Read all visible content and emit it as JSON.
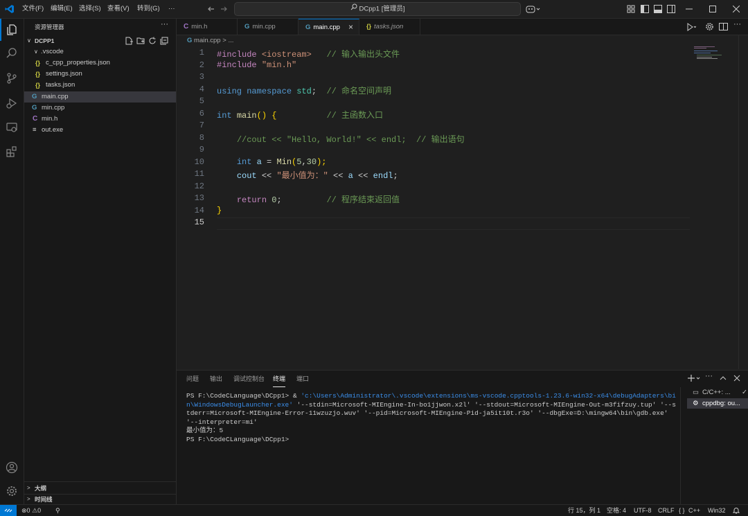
{
  "titlebar": {
    "menus": [
      "文件(F)",
      "编辑(E)",
      "选择(S)",
      "查看(V)",
      "转到(G)",
      "···"
    ],
    "command_center": "DCpp1 [管理员]",
    "accent": "#0078d4"
  },
  "sidebar": {
    "title": "资源管理器",
    "root": "DCPP1",
    "items": [
      {
        "label": ".vscode",
        "icon": "chevron-down-icon",
        "depth": 1
      },
      {
        "label": "c_cpp_properties.json",
        "icon": "json-icon",
        "depth": 2
      },
      {
        "label": "settings.json",
        "icon": "json-icon",
        "depth": 2
      },
      {
        "label": "tasks.json",
        "icon": "json-icon",
        "depth": 2
      },
      {
        "label": "main.cpp",
        "icon": "cpp-file-icon",
        "depth": 1,
        "selected": true
      },
      {
        "label": "min.cpp",
        "icon": "cpp-file-icon",
        "depth": 1
      },
      {
        "label": "min.h",
        "icon": "c-header-icon",
        "depth": 1
      },
      {
        "label": "out.exe",
        "icon": "binary-file-icon",
        "depth": 1
      }
    ],
    "outline": "大纲",
    "timeline": "时间线"
  },
  "tabs": [
    {
      "label": "min.h",
      "icon": "c-header-icon"
    },
    {
      "label": "min.cpp",
      "icon": "cpp-file-icon"
    },
    {
      "label": "main.cpp",
      "icon": "cpp-file-icon",
      "active": true,
      "close": "×"
    },
    {
      "label": "tasks.json",
      "icon": "json-icon",
      "italic": true
    }
  ],
  "editor": {
    "breadcrumb": "main.cpp",
    "breadcrumb_sep": ">",
    "current_line": 15,
    "lines": [
      "1",
      "2",
      "3",
      "4",
      "5",
      "6",
      "7",
      "8",
      "9",
      "10",
      "11",
      "12",
      "13",
      "14",
      "15"
    ],
    "tokens": {
      "l1_inc": "#include",
      "l1_hdr": "<iostream>",
      "l1_cm": "// 输入输出头文件",
      "l2_inc": "#include",
      "l2_hdr": "\"min.h\"",
      "l4_using": "using",
      "l4_ns": "namespace",
      "l4_std": "std",
      "l4_semi": ";",
      "l4_cm": "// 命名空间声明",
      "l6_int": "int",
      "l6_main": "main",
      "l6_paren": "()",
      "l6_brace": "{",
      "l6_cm": "// 主函数入口",
      "l8_cm": "//cout << \"Hello, World!\" << endl;  // 输出语句",
      "l10_int": "int",
      "l10_a": "a",
      "l10_eq": " = ",
      "l10_fn": "Min",
      "l10_p1": "(",
      "l10_n1": "5",
      "l10_comma": ",",
      "l10_n2": "30",
      "l10_p2": ");",
      "l11_cout": "cout",
      "l11_op": " << ",
      "l11_str": "\"最小值为：\"",
      "l11_op2": " << ",
      "l11_a": "a",
      "l11_op3": " << ",
      "l11_endl": "endl",
      "l11_semi": ";",
      "l13_ret": "return",
      "l13_n": "0",
      "l13_semi": ";",
      "l13_cm": "// 程序结束返回值",
      "l14_brace": "}"
    }
  },
  "panel": {
    "tabs": [
      "问题",
      "输出",
      "调试控制台",
      "终端",
      "端口"
    ],
    "active_tab": "终端",
    "terminal": {
      "prompt1": "PS F:\\CodeCLanguage\\DCpp1> ",
      "cmd_amp": "& ",
      "cmd_path": "'c:\\Users\\Administrator\\.vscode\\extensions\\ms-vscode.cpptools-1.23.6-win32-x64\\debugAdapters\\bin\\WindowsDebugLauncher.exe'",
      "cmd_args": " '--stdin=Microsoft-MIEngine-In-bo1jjwon.x2l' '--stdout=Microsoft-MIEngine-Out-m3fifzuy.tup' '--stderr=Microsoft-MIEngine-Error-11wzuzjo.wuv' '--pid=Microsoft-MIEngine-Pid-ja5it10t.r3o' '--dbgExe=D:\\mingw64\\bin\\gdb.exe' '--interpreter=mi'",
      "output": "最小值为：5",
      "prompt2": "PS F:\\CodeCLanguage\\DCpp1>"
    },
    "side_items": [
      "C/C++: ...",
      "cppdbg: ou..."
    ]
  },
  "status": {
    "errors": "0",
    "warnings": "0",
    "position": "行 15，列 1",
    "spaces": "空格: 4",
    "encoding": "UTF-8",
    "eol": "CRLF",
    "language": "C++",
    "language_braces": "{ }",
    "platform": "Win32"
  }
}
